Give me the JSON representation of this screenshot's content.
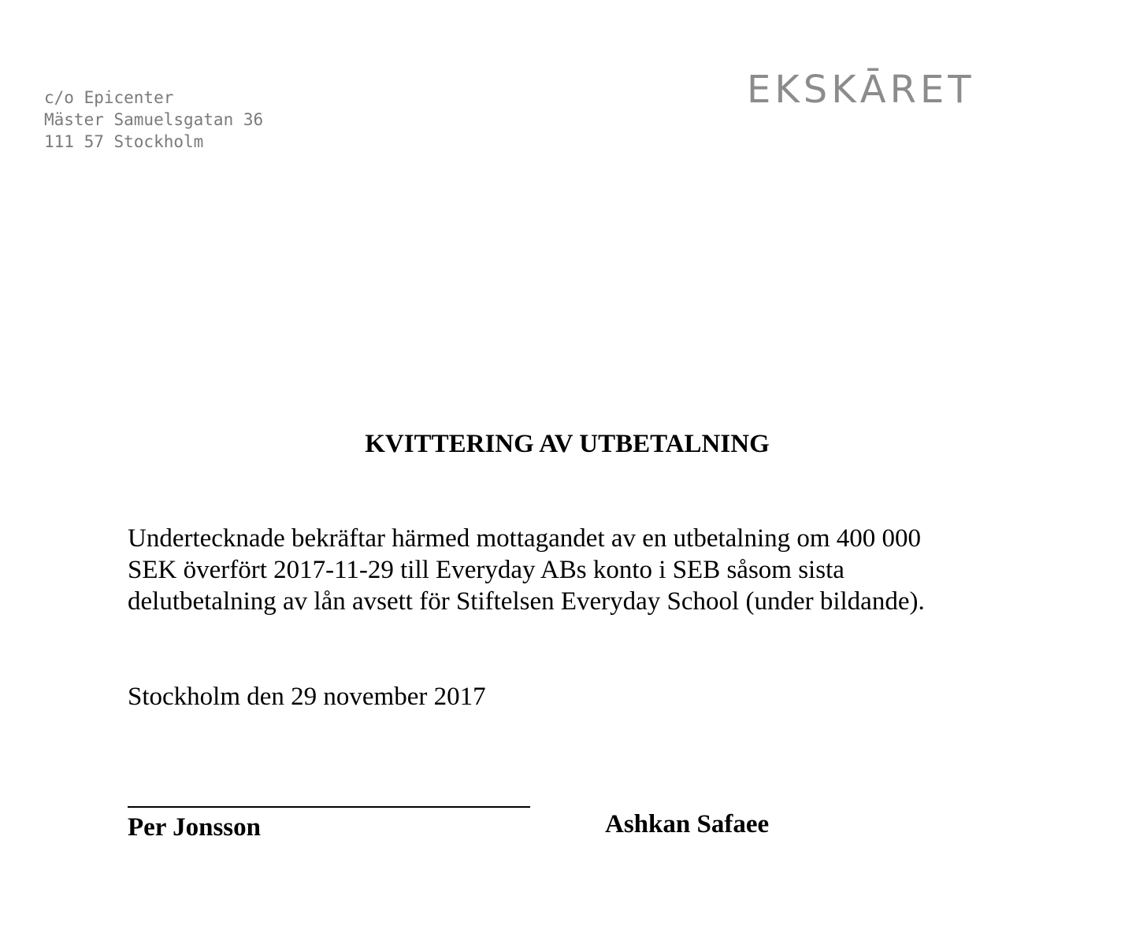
{
  "sender_address": {
    "line1": "c/o Epicenter",
    "line2": "Mäster Samuelsgatan 36",
    "line3": "111 57 Stockholm"
  },
  "logo": {
    "text": "EKSKĀRET"
  },
  "document": {
    "title": "KVITTERING AV UTBETALNING",
    "body_lines": [
      "Undertecknade bekräftar härmed mottagandet av en utbetalning om 400 000",
      "SEK överfört 2017-11-29 till Everyday ABs konto i SEB såsom sista",
      "delutbetalning av lån avsett för Stiftelsen Everyday School (under bildande)."
    ],
    "place_date": "Stockholm den 29 november 2017"
  },
  "signatures": {
    "signer1": "Per Jonsson",
    "signer2": "Ashkan Safaee"
  }
}
